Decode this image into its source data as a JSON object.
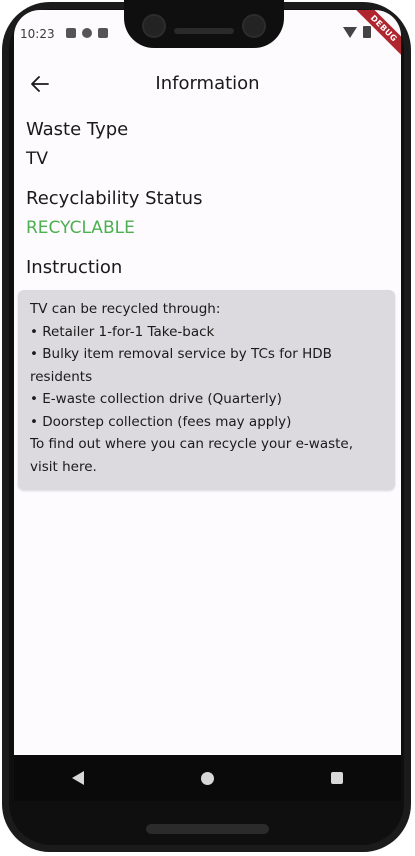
{
  "status_bar": {
    "time": "10:23",
    "debug_label": "DEBUG"
  },
  "app_bar": {
    "title": "Information"
  },
  "waste_type": {
    "label": "Waste Type",
    "value": "TV"
  },
  "recyclability": {
    "label": "Recyclability Status",
    "value": "RECYCLABLE",
    "color": "#4caf50"
  },
  "instruction": {
    "label": "Instruction",
    "lines": [
      "TV can be recycled through:",
      "• Retailer 1-for-1 Take-back",
      "• Bulky item removal service by TCs for HDB residents",
      "• E-waste collection drive  (Quarterly)",
      "• Doorstep collection (fees may apply)",
      "To find out where you can recycle your e-waste, visit here."
    ]
  }
}
